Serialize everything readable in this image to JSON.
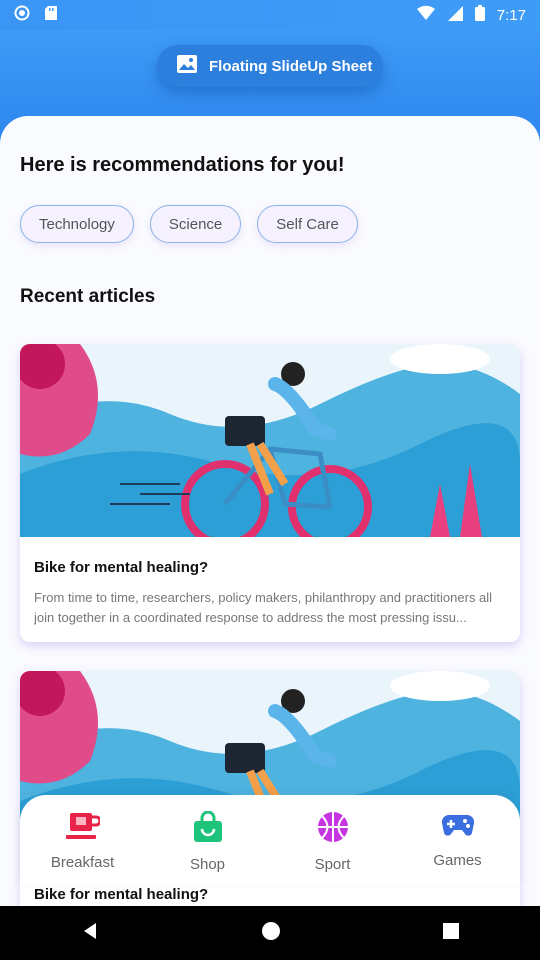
{
  "status_bar": {
    "time": "7:17",
    "icons": [
      "record-icon",
      "sd-card-icon",
      "wifi-icon",
      "signal-icon",
      "battery-icon"
    ]
  },
  "header": {
    "pill_label": "Floating SlideUp Sheet",
    "pill_icon": "image-icon"
  },
  "sheet": {
    "title": "Here is recommendations for you!",
    "chips": [
      "Technology",
      "Science",
      "Self Care"
    ],
    "section_title": "Recent articles",
    "articles": [
      {
        "title": "Bike for mental healing?",
        "description": "From time to time, researchers, policy makers, philanthropy and practitioners all join together in a coordinated response to address the most pressing issu..."
      },
      {
        "title": "Bike for mental healing?"
      }
    ]
  },
  "bottom_nav": {
    "items": [
      {
        "label": "Breakfast",
        "icon": "coffee-cup-icon",
        "color": "#e8234a"
      },
      {
        "label": "Shop",
        "icon": "shopping-bag-icon",
        "color": "#1ec37a"
      },
      {
        "label": "Sport",
        "icon": "basketball-icon",
        "color": "#c636e0"
      },
      {
        "label": "Games",
        "icon": "gamepad-icon",
        "color": "#3b6fe0"
      }
    ]
  },
  "colors": {
    "primary": "#2f8bf0",
    "pill": "#2c7fdd"
  }
}
